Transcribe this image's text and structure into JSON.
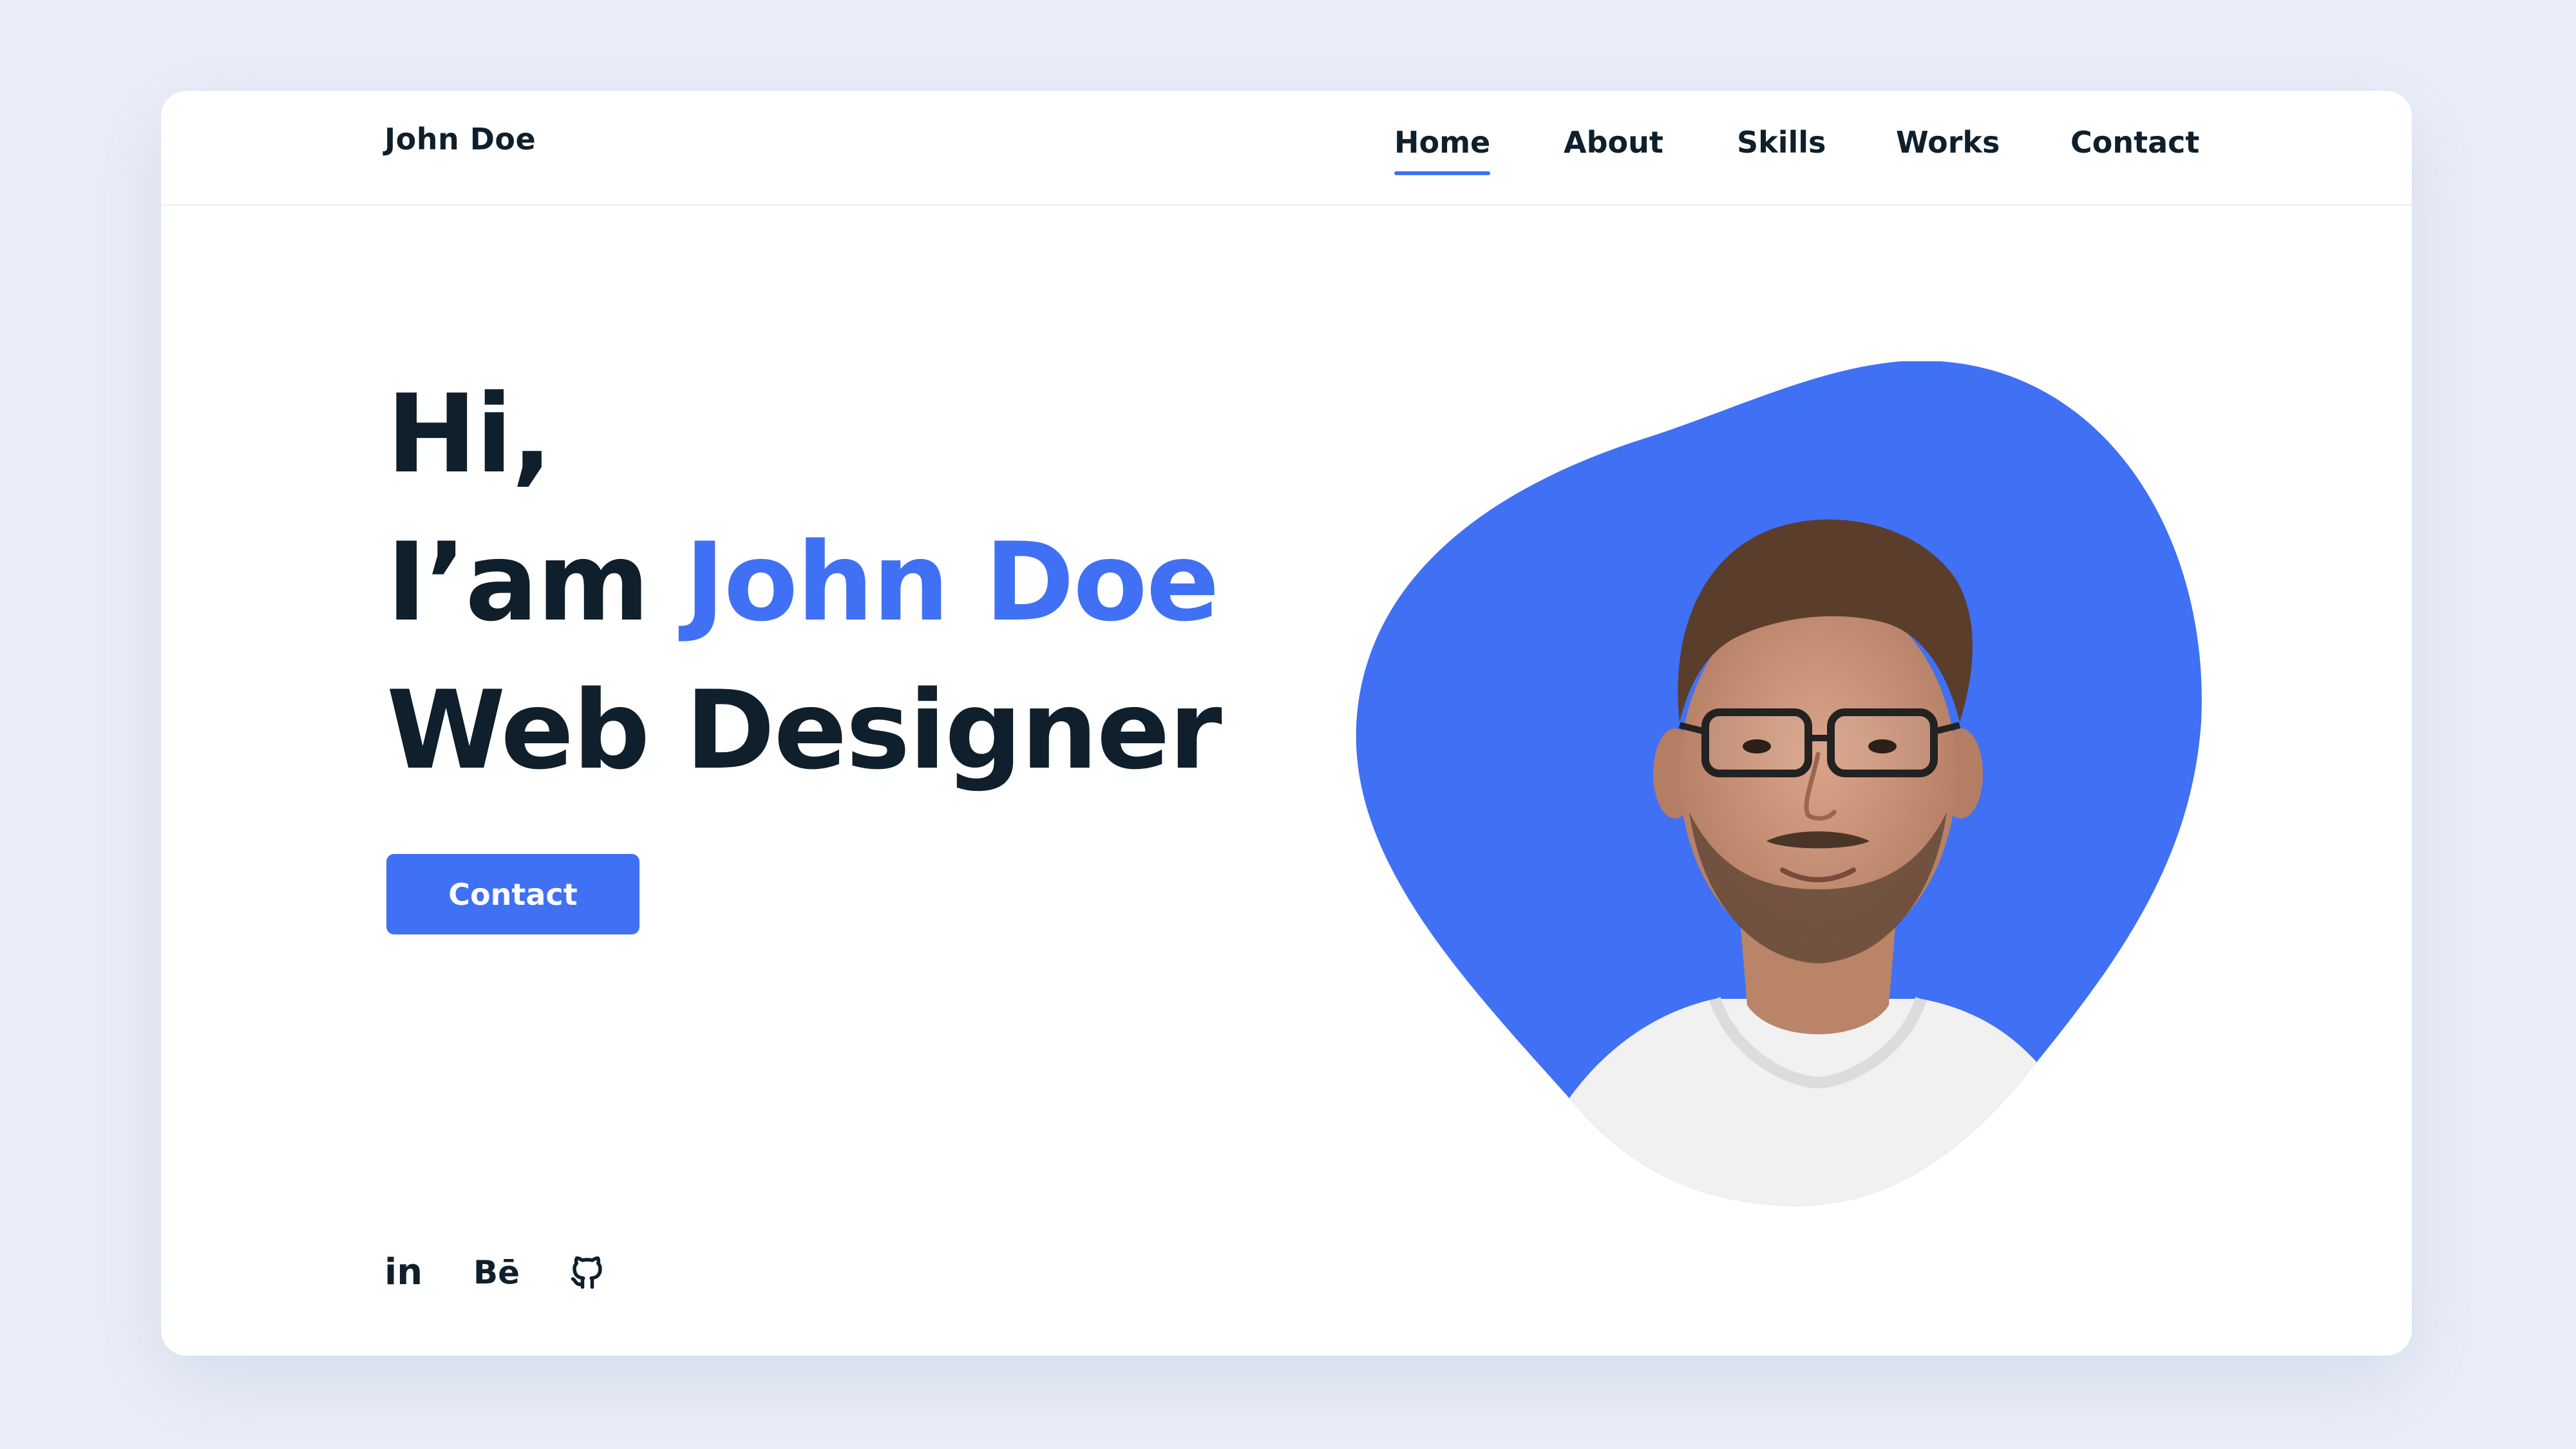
{
  "header": {
    "logo": "John Doe",
    "nav": [
      {
        "label": "Home",
        "active": true
      },
      {
        "label": "About",
        "active": false
      },
      {
        "label": "Skills",
        "active": false
      },
      {
        "label": "Works",
        "active": false
      },
      {
        "label": "Contact",
        "active": false
      }
    ]
  },
  "hero": {
    "line1": "Hi,",
    "line2_prefix": "I’am ",
    "line2_name": "John Doe",
    "line3": "Web Designer",
    "cta_label": "Contact"
  },
  "socials": {
    "linkedin_text": "in",
    "behance_text": "Bē",
    "icons": [
      "linkedin-icon",
      "behance-icon",
      "github-icon"
    ]
  },
  "colors": {
    "accent": "#4070f4",
    "text": "#0f1f2b",
    "page_background": "#e9eef8",
    "card_background": "#ffffff"
  }
}
